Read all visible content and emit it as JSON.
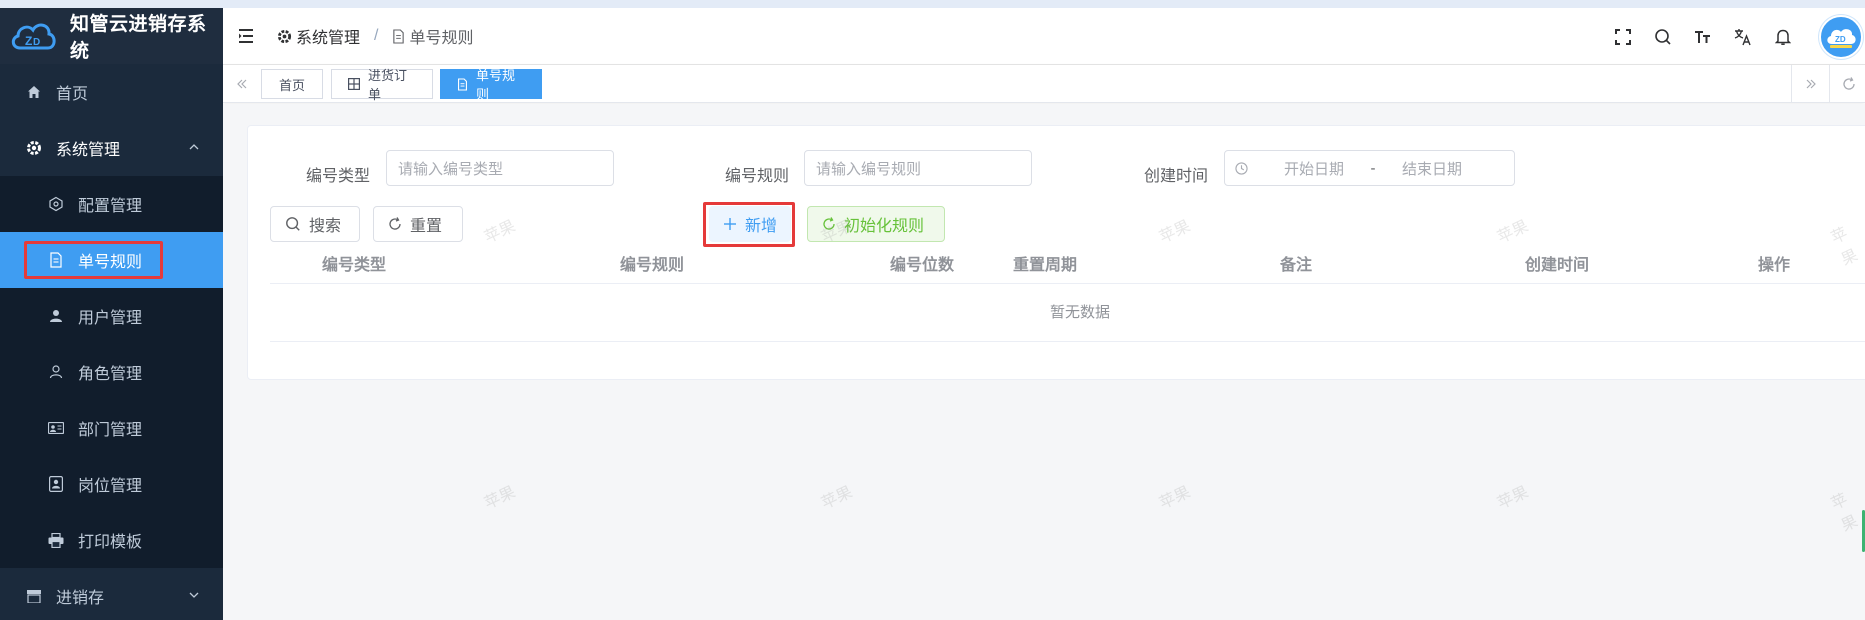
{
  "app": {
    "title": "知管云进销存系统",
    "logo_icon": "cloud-logo-icon",
    "accent": "#3f9df2",
    "sidebar_bg": "#1b2a3c",
    "highlight": "#e53a3a"
  },
  "sidebar": {
    "home": {
      "label": "首页",
      "icon": "home-icon"
    },
    "system": {
      "label": "系统管理",
      "icon": "gear-icon",
      "arrow": "^"
    },
    "sub_items": [
      {
        "label": "配置管理",
        "icon": "hexagon-icon"
      },
      {
        "label": "单号规则",
        "icon": "document-icon",
        "active": true
      },
      {
        "label": "用户管理",
        "icon": "user-icon"
      },
      {
        "label": "角色管理",
        "icon": "user-outline-icon"
      },
      {
        "label": "部门管理",
        "icon": "id-card-icon"
      },
      {
        "label": "岗位管理",
        "icon": "badge-icon"
      },
      {
        "label": "打印模板",
        "icon": "printer-icon"
      }
    ],
    "next_group": {
      "label": "进销存",
      "icon": "store-icon",
      "arrow": "v"
    }
  },
  "navbar": {
    "breadcrumb": [
      {
        "label": "系统管理",
        "icon": "gear-icon"
      },
      {
        "label": "单号规则",
        "icon": "document-icon"
      }
    ],
    "separator": "/",
    "icons": [
      "fullscreen-icon",
      "search-icon",
      "font-size-icon",
      "translate-icon",
      "bell-icon",
      "avatar"
    ]
  },
  "tags": [
    {
      "label": "首页",
      "active": false
    },
    {
      "label": "进货订单",
      "icon": "grid-icon",
      "active": false
    },
    {
      "label": "单号规则",
      "icon": "document-icon",
      "active": true
    }
  ],
  "filters": {
    "type": {
      "label": "编号类型",
      "placeholder": "请输入编号类型"
    },
    "rule": {
      "label": "编号规则",
      "placeholder": "请输入编号规则"
    },
    "created": {
      "label": "创建时间",
      "start_placeholder": "开始日期",
      "separator": "-",
      "end_placeholder": "结束日期"
    }
  },
  "buttons": {
    "search": "搜索",
    "reset": "重置",
    "add": "新增",
    "init": "初始化规则"
  },
  "table": {
    "columns": [
      "编号类型",
      "编号规则",
      "编号位数",
      "重置周期",
      "备注",
      "创建时间",
      "操作"
    ],
    "empty_text": "暂无数据"
  },
  "watermark": "苹果"
}
